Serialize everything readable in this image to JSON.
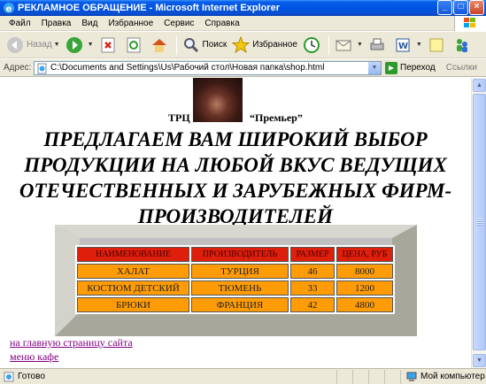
{
  "window": {
    "title": "РЕКЛАМНОЕ ОБРАЩЕНИЕ - Microsoft Internet Explorer"
  },
  "menu": [
    "Файл",
    "Правка",
    "Вид",
    "Избранное",
    "Сервис",
    "Справка"
  ],
  "toolbar": {
    "back_label": "Назад",
    "search_label": "Поиск",
    "favorites_label": "Избранное"
  },
  "address": {
    "label": "Адрес:",
    "value": "C:\\Documents and Settings\\Us\\Рабочий стол\\Новая папка\\shop.html",
    "go_label": "Переход",
    "links_label": "Ссылки"
  },
  "page": {
    "trc": "ТРЦ",
    "premier": "“Премьер”",
    "headline": "ПРЕДЛАГАЕМ ВАМ ШИРОКИЙ ВЫБОР ПРОДУКЦИИ НА ЛЮБОЙ ВКУС ВЕДУЩИХ ОТЕЧЕСТВЕННЫХ И ЗАРУБЕЖНЫХ ФИРМ-ПРОИЗВОДИТЕЛЕЙ",
    "table": {
      "headers": [
        "НАИМЕНОВАНИЕ",
        "ПРОИЗВОДИТЕЛЬ",
        "РАЗМЕР",
        "ЦЕНА, РУБ"
      ],
      "rows": [
        [
          "ХАЛАТ",
          "ТУРЦИЯ",
          "46",
          "8000"
        ],
        [
          "КОСТЮМ ДЕТСКИЙ",
          "ТЮМЕНЬ",
          "33",
          "1200"
        ],
        [
          "БРЮКИ",
          "ФРАНЦИЯ",
          "42",
          "4800"
        ]
      ]
    },
    "links": [
      "на главную страницу сайта",
      "меню кафе"
    ]
  },
  "status": {
    "text": "Готово",
    "zone": "Мой компьютер"
  },
  "colors": {
    "header_bg": "#dd1f0b",
    "cell_bg": "#ff9c05",
    "link": "#800080"
  }
}
